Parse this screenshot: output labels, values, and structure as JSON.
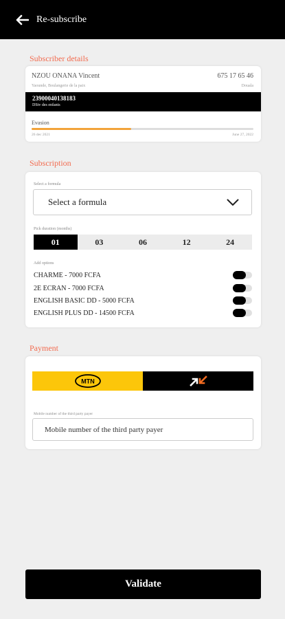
{
  "header": {
    "title": "Re-subscribe",
    "back_icon": "arrow-left-icon"
  },
  "subscriber": {
    "section_title": "Subscriber details",
    "name": "NZOU ONANA Vincent",
    "phone": "675 17 65 46",
    "address": "Yaounde, Boulangerie de la paix",
    "city": "Douala",
    "decoder_number": "23900040138183",
    "decoder_label": "DStv des enfants",
    "offer": "Evasion",
    "progress": 0.45,
    "start_date": "26 dec 2021",
    "end_date": "June 27, 2022",
    "progress_color": "#f2a33a"
  },
  "subscription": {
    "section_title": "Subscription",
    "formula_label": "Select a formula",
    "formula_value": "Select a formula",
    "duration_label": "Pick duration (months)",
    "durations": [
      "01",
      "03",
      "06",
      "12",
      "24"
    ],
    "selected_duration": "01",
    "options_label": "Add options",
    "options": [
      {
        "label": "CHARME - 7000 FCFA",
        "enabled": false
      },
      {
        "label": "2E ECRAN - 7000 FCFA",
        "enabled": false
      },
      {
        "label": "ENGLISH BASIC DD - 5000 FCFA",
        "enabled": false
      },
      {
        "label": "ENGLISH PLUS DD - 14500 FCFA",
        "enabled": false
      }
    ]
  },
  "payment": {
    "section_title": "Payment",
    "mtn_logo_text": "MTN",
    "mtn_color": "#fcc60a",
    "orange_color": "#f26b21",
    "phone_label": "Mobile number of the third party payer",
    "phone_placeholder": "Mobile number of the third party payer"
  },
  "validate_label": "Validate",
  "accent_color": "#f26b4f"
}
